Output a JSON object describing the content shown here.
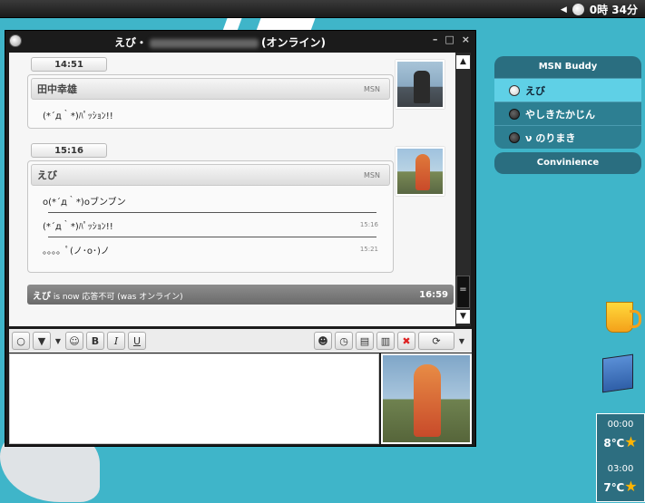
{
  "topbar": {
    "clock": "0時 34分"
  },
  "window": {
    "title_name": "えび・",
    "title_status": "(オンライン)",
    "controls": [
      "–",
      "□",
      "×"
    ]
  },
  "conversation": {
    "blocks": [
      {
        "time": "14:51",
        "name": "田中幸雄",
        "service": "MSN",
        "lines": [
          {
            "text": "(*´д｀*)ﾊﾟｯｼｮﾝ!!",
            "time": ""
          }
        ]
      },
      {
        "time": "15:16",
        "name": "えび",
        "service": "MSN",
        "lines": [
          {
            "text": "o(*´д｀*)oブンブン",
            "time": ""
          },
          {
            "text": "(*´д｀*)ﾊﾟｯｼｮﾝ!!",
            "time": "15:16"
          },
          {
            "text": "。。。。ﾟ(ノ･o･)ノ",
            "time": "15:21"
          }
        ]
      }
    ],
    "status": {
      "name": "えび",
      "text": "is now 応答不可 (was オンライン)",
      "time": "16:59"
    }
  },
  "buddy_panel": {
    "title": "MSN Buddy",
    "items": [
      {
        "label": "えび",
        "selected": true
      },
      {
        "label": "やしきたかじん",
        "selected": false
      },
      {
        "label": "ν のりまき",
        "selected": false
      }
    ],
    "convenience": "Convinience"
  },
  "weather": [
    {
      "time": "00:00",
      "temp": "8℃"
    },
    {
      "time": "03:00",
      "temp": "7℃"
    }
  ]
}
